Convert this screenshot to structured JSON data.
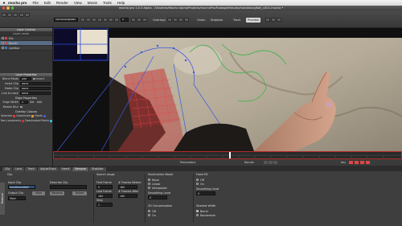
{
  "menubar": {
    "apple": "",
    "items": [
      "mocha pro",
      "File",
      "Edit",
      "Render",
      "View",
      "Movie",
      "Tools",
      "Help"
    ]
  },
  "window": {
    "title": "mocha pro 1.0.3 Alpha - /Volumes/Mocha Alpha/Projects/mochaPro/Footage/Results/handAlongWall_v001.mocha *"
  },
  "toolbar": {
    "clip_value": "handAlongWall",
    "frame_value": "0",
    "overlays_label": "Overlays",
    "onion_label": "Onion",
    "stabilize_label": "Stabilize",
    "track_label": "Track",
    "preview_label": "Preview"
  },
  "layer_controls": {
    "title": "Layer Controls",
    "header": "Layer name",
    "layers": [
      {
        "name": "fills",
        "color": "#e04848"
      },
      {
        "name": "Border",
        "color": "#e04848",
        "selected": true
      },
      {
        "name": "Lightbar",
        "color": "#3b7ee0"
      }
    ]
  },
  "layer_properties": {
    "title": "Layer Properties",
    "blend_label": "Blend Mode",
    "blend_value": "Add",
    "invert_label": "Invert",
    "insert_label": "Insert Clip",
    "insert_value": "None",
    "matte_label": "Matte Clip",
    "matte_value": "None",
    "link_label": "Link to track",
    "link_value": "None",
    "edge_head": "Edge Properties",
    "edge_width_label": "Edge Width",
    "edge_width_value": "0",
    "set_label": "Set",
    "add_label": "Add",
    "motion_blur_label": "Motion Blur",
    "overlay_head": "Overlay Colours",
    "selected_label": "Selected",
    "unselected_label": "Unselected",
    "points_label": "Points",
    "nonlandmarks_label": "Non Landmarks",
    "deactivated_label": "Deactivated Points"
  },
  "timeline": {
    "params_label": "Parameters",
    "render_label": "Render",
    "key_label": "Key"
  },
  "bottom_tabs": [
    "Clip",
    "Lens",
    "Track",
    "AdjustTrack",
    "Insert",
    "Remove",
    "Stabilize"
  ],
  "active_tab": "Remove",
  "params": {
    "vertical_tab": "Remove",
    "clip_label": "Clip",
    "input_clip_label": "Input Clip",
    "input_clip_value": "handAlongWall",
    "output_clip_label": "Output Clip",
    "output_value": "Main",
    "view_label": "View",
    "describe_label": "Describe Clip",
    "rename_label": "Rename",
    "delete_label": "Delete",
    "search_label": "Search range",
    "first_frame_label": "First Frame",
    "first_frame_value": "0",
    "last_frame_label": "Last Frame",
    "last_frame_value": "184",
    "step_label": "Step",
    "step_value": "1",
    "frames_before_label": "# Frames Before",
    "frames_before_value": "180",
    "frames_after_label": "# Frames After",
    "frames_after_value": "180",
    "illumination_label": "Illumination Model",
    "illum_none": "None",
    "illum_linear": "Linear",
    "illum_interp": "Interpolate",
    "smoothing_label": "Smoothing Level",
    "smoothing_value": "0",
    "fixed_fill_label": "Fixed Fill",
    "fixed_off": "Off",
    "fixed_on": "On",
    "fixed_smoothing_label": "Smoothing Level",
    "fixed_smoothing_value": "0",
    "zoom_comp_label": "2D Compensation",
    "zoom_off": "Off",
    "zoom_on": "On",
    "shadow_label": "Shadow Width",
    "blend_label": "Blend",
    "randomize_label": "Randomize"
  }
}
